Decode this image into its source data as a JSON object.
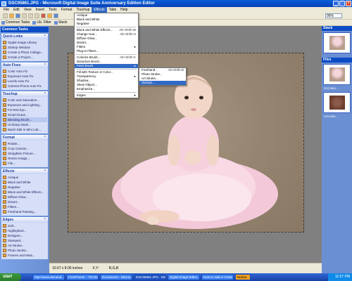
{
  "window": {
    "title": "DSC05861.JPG - Microsoft Digital Image Suite Anniversary Edition Editor",
    "buttons": [
      "_",
      "□",
      "×"
    ]
  },
  "menubar": {
    "items": [
      "File",
      "Edit",
      "View",
      "Insert",
      "Tools",
      "Format",
      "Touchup",
      "Effects",
      "Tabs",
      "Help"
    ],
    "active_index": 7
  },
  "toolbar": {
    "zoom": "95%"
  },
  "toolbar2": {
    "items": [
      "Common Tasks",
      "Lib. Filter",
      "Stack"
    ]
  },
  "effects_menu": {
    "items": [
      {
        "label": "Antique",
        "shortcut": "",
        "arrow": false
      },
      {
        "label": "Black and White",
        "shortcut": "",
        "arrow": false
      },
      {
        "label": "Negative",
        "shortcut": "",
        "arrow": false
      },
      {
        "sep": true
      },
      {
        "label": "Black and White Effects...",
        "shortcut": "Alt+Shift+W",
        "arrow": false
      },
      {
        "label": "Change Hue...",
        "shortcut": "Alt+Shift+H",
        "arrow": false
      },
      {
        "label": "Diffuse Glow...",
        "shortcut": "",
        "arrow": false
      },
      {
        "label": "Distort...",
        "shortcut": "",
        "arrow": false
      },
      {
        "label": "Filters",
        "shortcut": "",
        "arrow": true
      },
      {
        "label": "Plug-in Filters...",
        "shortcut": "",
        "arrow": false
      },
      {
        "sep": true
      },
      {
        "label": "Colorize Brush...",
        "shortcut": "Alt+Shift+C",
        "arrow": false
      },
      {
        "label": "Distortion Brush...",
        "shortcut": "",
        "arrow": false
      },
      {
        "label": "Paint Brush",
        "shortcut": "",
        "arrow": true,
        "highlighted": true
      },
      {
        "sep": true
      },
      {
        "label": "Fill with Texture or Color...",
        "shortcut": "",
        "arrow": false
      },
      {
        "label": "Transparency",
        "shortcut": "",
        "arrow": true
      },
      {
        "label": "Shadow...",
        "shortcut": "",
        "arrow": false
      },
      {
        "label": "Skew Object...",
        "shortcut": "",
        "arrow": false
      },
      {
        "label": "Emphasize...",
        "shortcut": "",
        "arrow": false
      },
      {
        "sep": true
      },
      {
        "label": "Edges",
        "shortcut": "",
        "arrow": true
      }
    ]
  },
  "paint_submenu": {
    "items": [
      {
        "label": "Freehand...",
        "shortcut": "Alt+Shift+B"
      },
      {
        "label": "Photo Stroke..."
      },
      {
        "label": "Art Stroke..."
      },
      {
        "label": "Stamps...",
        "highlighted": true
      }
    ]
  },
  "left_pane": {
    "title": "Common Tasks",
    "groups": [
      {
        "title": "Quick Links",
        "items": [
          "Digital Image Library",
          "Startup Window",
          "Create a Photo Collage...",
          "Create a Project..."
        ]
      },
      {
        "title": "Auto Fixes",
        "items": [
          "Color Auto Fix",
          "Exposure Auto Fix",
          "Levels Auto Fix",
          "Camera Phone Auto Fix"
        ]
      },
      {
        "title": "Touchup",
        "items": [
          "Color and Saturation...",
          "Exposure and Lighting...",
          "Fix Red Eye...",
          "Smart Erase...",
          "Blending Brush...",
          "Unsharp Mask...",
          "Batch Edit in Mini Lab..."
        ],
        "selected": 4
      },
      {
        "title": "Format",
        "items": [
          "Rotate...",
          "Crop Canvas...",
          "Straighten Picture...",
          "Resize Image...",
          "File..."
        ]
      },
      {
        "title": "Effects",
        "items": [
          "Antique",
          "Black and White",
          "Negative",
          "Black and White Effects...",
          "Diffuse Glow...",
          "Distort...",
          "Filters...",
          "Freehand Painting..."
        ]
      },
      {
        "title": "Edges",
        "items": [
          "Soft...",
          "Highlighted...",
          "Designer...",
          "Stamped...",
          "Art Stroke...",
          "Photo Stroke...",
          "Frames and Mats..."
        ]
      }
    ]
  },
  "right_pane": {
    "stack_title": "Stack",
    "files_title": "Files",
    "file1": "DSC0861...",
    "file2": "DSC0861..."
  },
  "status": {
    "size": "10.67 x 8.00 inches",
    "xy": "X,Y:",
    "rgb": "R,G,B"
  },
  "taskbar": {
    "start": "start",
    "tasks": [
      "http://www.demand...",
      "FreePhoner - \"SCHU...",
      "Document4 - Micros...",
      "DSC05861.JPG - Mic...",
      "Digital Image Editor ...",
      "How to Add or Creat..."
    ],
    "active_index": 3,
    "norton": "Norton",
    "clock": "11:57 PM"
  }
}
